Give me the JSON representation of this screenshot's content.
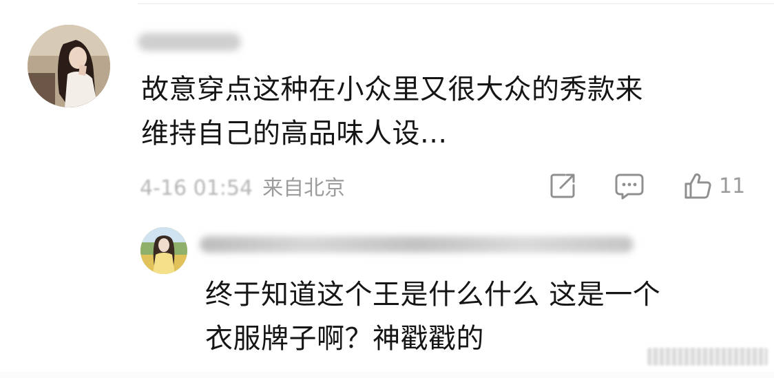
{
  "main_comment": {
    "text_line1": "故意穿点这种在小众里又很大众的秀款来",
    "text_line2": "维持自己的高品味人设...",
    "time": "4-16 01:54",
    "location": "来自北京",
    "like_count": "11"
  },
  "icons": {
    "share": "share-icon",
    "comment": "comment-icon",
    "like": "thumbs-up-icon"
  },
  "reply": {
    "text_line1": "终于知道这个王是什么什么 这是一个",
    "text_line2": "衣服牌子啊？神戳戳的"
  },
  "colors": {
    "text": "#151515",
    "meta": "#a8a8a8",
    "icon": "#8f8f8f"
  }
}
